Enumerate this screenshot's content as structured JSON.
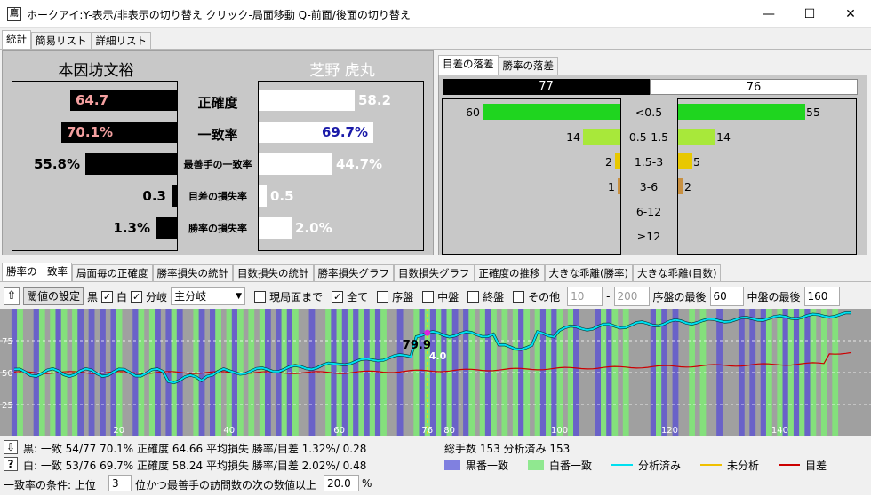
{
  "window": {
    "title": "ホークアイ:Y-表示/非表示の切り替え クリック-局面移動 Q-前面/後面の切り替え",
    "icon": "鷹",
    "min": "—",
    "max": "☐",
    "close": "✕"
  },
  "top_tabs": [
    "統計",
    "簡易リスト",
    "詳細リスト"
  ],
  "stats": {
    "black_name": "本因坊文裕",
    "white_name": "芝野 虎丸",
    "rows": [
      {
        "label": "正確度",
        "black": "64.7",
        "white": "58.2",
        "black_frac": 0.647,
        "white_frac": 0.582
      },
      {
        "label": "一致率",
        "black": "70.1%",
        "white": "69.7%",
        "black_frac": 0.701,
        "white_frac": 0.697
      },
      {
        "label": "最善手の一致率",
        "black": "55.8%",
        "white": "44.7%",
        "black_frac": 0.558,
        "white_frac": 0.447
      },
      {
        "label": "目差の損失率",
        "black": "0.3",
        "white": "0.5",
        "black_frac": 0.03,
        "white_frac": 0.05
      },
      {
        "label": "勝率の損失率",
        "black": "1.3%",
        "white": "2.0%",
        "black_frac": 0.13,
        "white_frac": 0.2
      }
    ]
  },
  "diff_tabs": [
    "目差の落差",
    "勝率の落差"
  ],
  "diff": {
    "black_total": "77",
    "white_total": "76",
    "rows": [
      {
        "label": "<0.5",
        "black": "60",
        "white": "55",
        "bfrac": 1.0,
        "wfrac": 0.92,
        "color": "#1fd51f"
      },
      {
        "label": "0.5-1.5",
        "black": "14",
        "white": "14",
        "bfrac": 0.27,
        "wfrac": 0.27,
        "color": "#a8e83a"
      },
      {
        "label": "1.5-3",
        "black": "2",
        "white": "5",
        "bfrac": 0.04,
        "wfrac": 0.1,
        "color": "#e8c800"
      },
      {
        "label": "3-6",
        "black": "1",
        "white": "2",
        "bfrac": 0.02,
        "wfrac": 0.04,
        "color": "#c89040"
      },
      {
        "label": "6-12",
        "black": "",
        "white": "",
        "bfrac": 0,
        "wfrac": 0,
        "color": "#c89040"
      },
      {
        "label": "≥12",
        "black": "",
        "white": "",
        "bfrac": 0,
        "wfrac": 0,
        "color": "#c89040"
      }
    ]
  },
  "bottom_tabs": [
    "勝率の一致率",
    "局面毎の正確度",
    "勝率損失の統計",
    "目数損失の統計",
    "勝率損失グラフ",
    "目数損失グラフ",
    "正確度の推移",
    "大きな乖離(勝率)",
    "大きな乖離(目数)"
  ],
  "toolbar": {
    "threshold_btn": "閾値の設定",
    "black": "黒",
    "white": "白",
    "branch": "分岐",
    "branch_select": "主分岐",
    "to_current": "現局面まで",
    "all": "全て",
    "opening": "序盤",
    "middle": "中盤",
    "endgame": "終盤",
    "other": "その他",
    "range_from": "10",
    "range_sep": "-",
    "range_to": "200",
    "opening_last": "序盤の最後",
    "opening_last_val": "60",
    "middle_last": "中盤の最後",
    "middle_last_val": "160"
  },
  "chart_data": {
    "type": "line",
    "yticks": [
      "75",
      "50",
      "25"
    ],
    "xticks": [
      "20",
      "40",
      "60",
      "76",
      "80",
      "100",
      "120",
      "140"
    ],
    "cursor_move": "76",
    "cursor_value": "79.9",
    "cursor_diff": "4.0",
    "ylim": [
      0,
      100
    ],
    "xlim": [
      1,
      153
    ]
  },
  "status": {
    "black_line": "黒: 一致 54/77 70.1% 正確度 64.66 平均損失 勝率/目差 1.32%/ 0.28",
    "white_line": "白: 一致 53/76 69.7% 正確度 58.24 平均損失 勝率/目差 2.02%/ 0.48",
    "total": "総手数 153 分析済み 153",
    "condition_a": "一致率の条件: 上位",
    "condition_n": "3",
    "condition_b": "位かつ最善手の訪問数の次の数値以上",
    "condition_pct": "20.0",
    "condition_unit": "%"
  },
  "legend": [
    {
      "label": "黒番一致",
      "color": "#8080e0",
      "kind": "box"
    },
    {
      "label": "白番一致",
      "color": "#90e890",
      "kind": "box"
    },
    {
      "label": "分析済み",
      "color": "#00e0f0",
      "kind": "line"
    },
    {
      "label": "未分析",
      "color": "#f0c000",
      "kind": "line"
    },
    {
      "label": "目差",
      "color": "#cc0000",
      "kind": "line"
    }
  ]
}
